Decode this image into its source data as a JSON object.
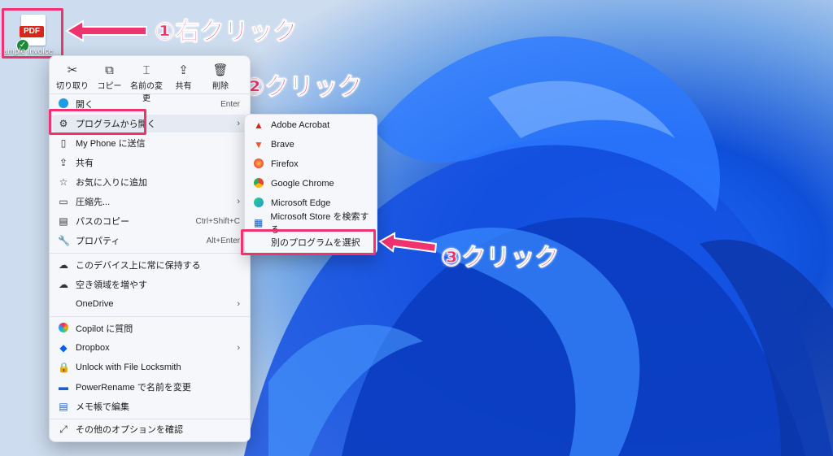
{
  "desktop": {
    "icon_badge": "PDF",
    "icon_label": "ample invoice ..."
  },
  "callouts": {
    "step1": "①右クリック",
    "step2": "②クリック",
    "step3": "③クリック"
  },
  "quick_actions": [
    "切り取り",
    "コピー",
    "名前の変更",
    "共有",
    "削除"
  ],
  "menu": {
    "open": "開く",
    "open_shortcut": "Enter",
    "open_with": "プログラムから開く",
    "send_phone": "My Phone に送信",
    "share": "共有",
    "favorite": "お気に入りに追加",
    "compress": "圧縮先...",
    "copy_path": "パスのコピー",
    "copy_path_shortcut": "Ctrl+Shift+C",
    "properties": "プロパティ",
    "properties_shortcut": "Alt+Enter",
    "keep_on_device": "このデバイス上に常に保持する",
    "free_space": "空き領域を増やす",
    "onedrive": "OneDrive",
    "copilot": "Copilot に質問",
    "dropbox": "Dropbox",
    "unlock": "Unlock with File Locksmith",
    "powerrename": "PowerRename で名前を変更",
    "notepad": "メモ帳で編集",
    "more_options": "その他のオプションを確認"
  },
  "submenu": {
    "acrobat": "Adobe Acrobat",
    "brave": "Brave",
    "firefox": "Firefox",
    "chrome": "Google Chrome",
    "edge": "Microsoft Edge",
    "store": "Microsoft Store を検索する",
    "choose_other": "別のプログラムを選択"
  },
  "colors": {
    "highlight": "#f0336f",
    "accent": "#1a5fd6"
  }
}
